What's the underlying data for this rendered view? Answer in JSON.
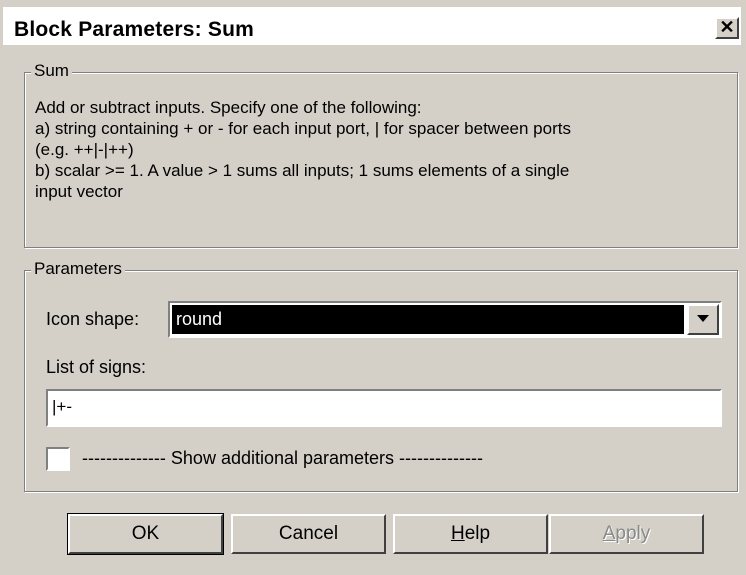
{
  "window": {
    "title": "Block Parameters: Sum",
    "close_symbol": "✕"
  },
  "sum_group": {
    "legend": "Sum",
    "description_lines": [
      "Add or subtract inputs.  Specify one of the following:",
      "a) string containing + or - for each input port, | for spacer between ports",
      "(e.g. ++|-|++)",
      "b) scalar >= 1. A value > 1 sums all inputs; 1 sums elements of a single",
      "input vector"
    ]
  },
  "parameters_group": {
    "legend": "Parameters",
    "icon_shape_label": "Icon shape:",
    "icon_shape_value": "round",
    "list_of_signs_label": "List of signs:",
    "list_of_signs_value": "|+-",
    "show_additional_label": "-------------- Show additional parameters --------------",
    "show_additional_checked": false
  },
  "buttons": {
    "ok": "OK",
    "cancel": "Cancel",
    "help": "Help",
    "apply": "Apply"
  },
  "icons": {
    "close": "close-icon",
    "dropdown": "chevron-down-icon"
  }
}
